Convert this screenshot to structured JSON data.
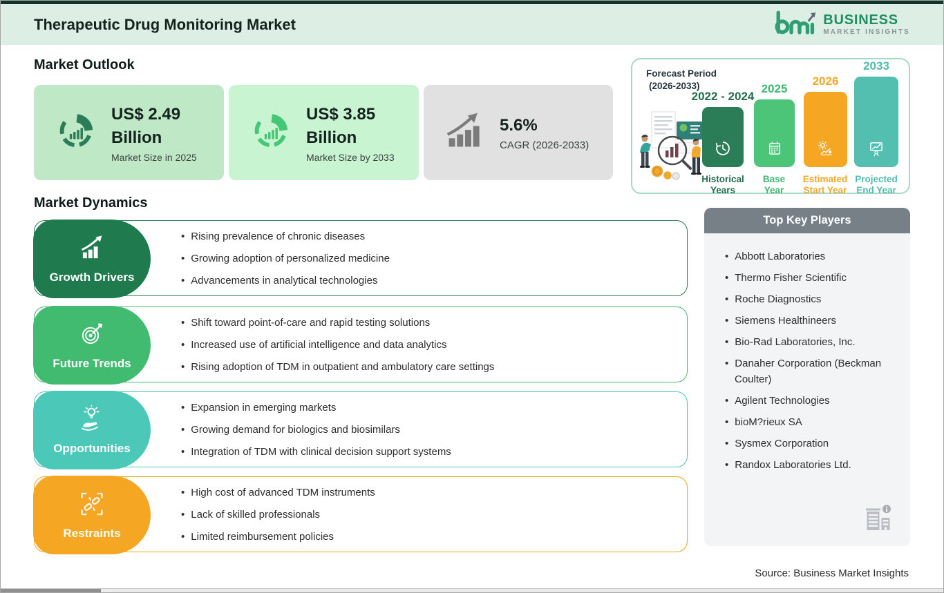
{
  "header": {
    "title": "Therapeutic Drug Monitoring Market",
    "logo": {
      "mark": "bmi",
      "business": "BUSINESS",
      "market_insights": "MARKET  INSIGHTS"
    }
  },
  "market_outlook": {
    "heading": "Market Outlook",
    "cards": [
      {
        "value": "US$ 2.49",
        "unit": "Billion",
        "caption": "Market Size in 2025",
        "bg": "#bfe9c6",
        "icon": "donut-bars-icon",
        "icon_color": "#2a7d56"
      },
      {
        "value": "US$ 3.85",
        "unit": "Billion",
        "caption": "Market Size by 2033",
        "bg": "#c9f4d2",
        "icon": "donut-bars-icon",
        "icon_color": "#44c777"
      },
      {
        "value": "5.6%",
        "caption": "CAGR (2026-2033)",
        "bg": "#e1e1e1",
        "icon": "growth-chart-icon",
        "icon_color": "#7b7b7b"
      }
    ]
  },
  "forecast_panel": {
    "title_line1": "Forecast Period",
    "title_line2": "(2026-2033)",
    "bars": [
      {
        "year": "2022 - 2024",
        "label_line1": "Historical",
        "label_line2": "Years",
        "color": "#2a7d56",
        "icon": "history-clock-icon"
      },
      {
        "year": "2025",
        "label_line1": "Base",
        "label_line2": "Year",
        "color": "#4cc579",
        "icon": "calendar-icon"
      },
      {
        "year": "2026",
        "label_line1": "Estimated",
        "label_line2": "Start Year",
        "color": "#f5a623",
        "icon": "gear-chart-icon"
      },
      {
        "year": "2033",
        "label_line1": "Projected",
        "label_line2": "End Year",
        "color": "#52bfb0",
        "icon": "presentation-icon"
      }
    ]
  },
  "market_dynamics": {
    "heading": "Market Dynamics",
    "rows": [
      {
        "label": "Growth Drivers",
        "color": "#1f7a4d",
        "icon": "growth-chart-icon",
        "bullets": [
          "Rising prevalence of chronic diseases",
          "Growing adoption of personalized medicine",
          "Advancements in analytical technologies"
        ]
      },
      {
        "label": "Future Trends",
        "color": "#41bb70",
        "icon": "target-icon",
        "bullets": [
          "Shift toward point-of-care and rapid testing solutions",
          "Increased use of artificial intelligence and data analytics",
          "Rising adoption of TDM in outpatient and ambulatory care settings"
        ]
      },
      {
        "label": "Opportunities",
        "color": "#4cc8b8",
        "icon": "hand-bulb-icon",
        "bullets": [
          "Expansion in emerging markets",
          "Growing demand for biologics and biosimilars",
          "Integration of TDM with clinical decision support systems"
        ]
      },
      {
        "label": "Restraints",
        "color": "#f5a623",
        "icon": "broken-link-icon",
        "bullets": [
          "High cost of advanced TDM instruments",
          "Lack of skilled professionals",
          "Limited reimbursement policies"
        ]
      }
    ]
  },
  "key_players": {
    "heading": "Top Key Players",
    "items": [
      "Abbott Laboratories",
      "Thermo Fisher Scientific",
      "Roche Diagnostics",
      "Siemens Healthineers",
      "Bio-Rad Laboratories, Inc.",
      "Danaher Corporation (Beckman Coulter)",
      "Agilent Technologies",
      "bioM?rieux SA",
      "Sysmex Corporation",
      "Randox Laboratories Ltd."
    ]
  },
  "footer": {
    "source": "Source: Business Market Insights"
  },
  "colors": {
    "header_band": "#ddefe5",
    "top_strip": "#11352c",
    "logo_green": "#1f8e63",
    "dark_green": "#1f7a4d",
    "green": "#41bb70",
    "teal": "#4cc8b8",
    "orange": "#f5a623",
    "players_header": "#778087",
    "players_body": "#f3f4f6"
  }
}
